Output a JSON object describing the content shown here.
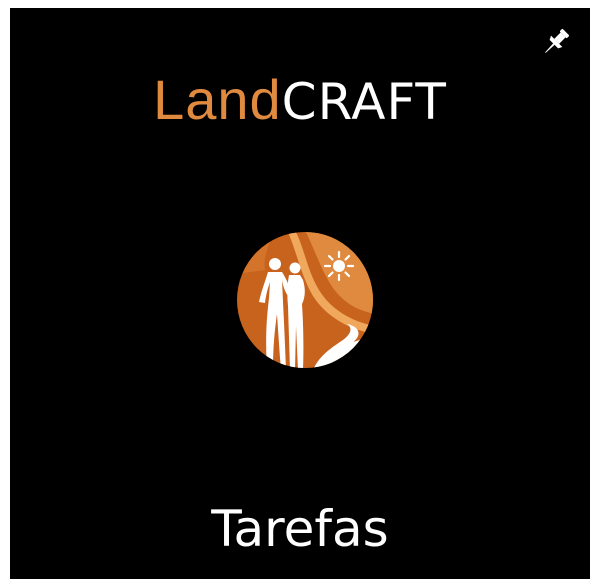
{
  "tile": {
    "brand": {
      "part1": "Land",
      "part2": "CRAFT"
    },
    "caption": "Tarefas",
    "icons": {
      "pin": "pin-icon",
      "logo": "landcraft-logo"
    },
    "colors": {
      "background": "#000000",
      "accent": "#e08a3f",
      "text": "#ffffff"
    }
  }
}
